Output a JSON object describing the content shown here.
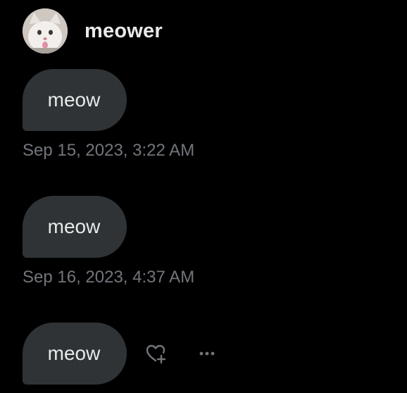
{
  "conversation": {
    "user": {
      "name": "meower",
      "avatar_icon": "cat-avatar"
    },
    "messages": [
      {
        "text": "meow",
        "timestamp": "Sep 15, 2023, 3:22 AM"
      },
      {
        "text": "meow",
        "timestamp": "Sep 16, 2023, 4:37 AM"
      },
      {
        "text": "meow",
        "timestamp": ""
      }
    ],
    "actions": {
      "react_icon": "heart-plus-icon",
      "more_icon": "more-icon"
    }
  },
  "colors": {
    "background": "#000000",
    "bubble": "#2f3336",
    "text": "#e7e9ea",
    "muted": "#71767b"
  }
}
